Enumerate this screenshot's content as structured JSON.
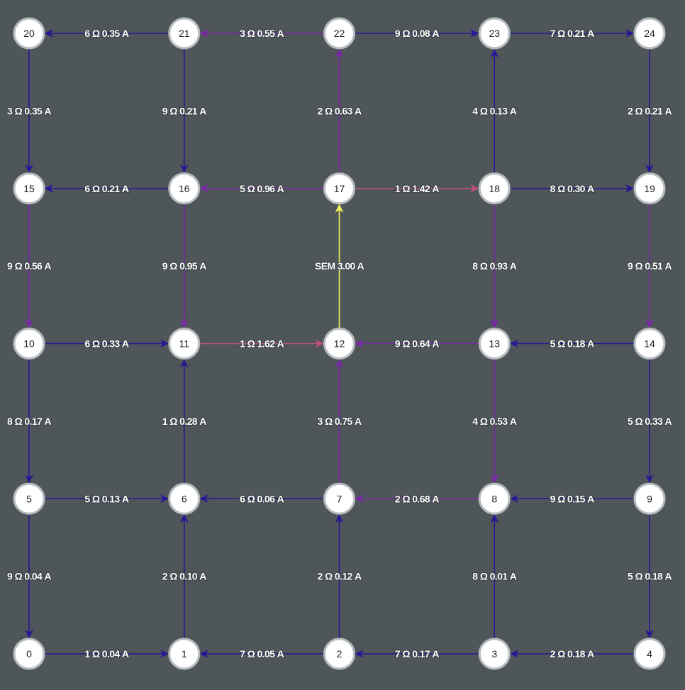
{
  "colors": {
    "background": "#4f5659",
    "node_fill": "#ffffff",
    "node_stroke": "#b7bcbf",
    "current_low": "#2a1596",
    "current_mid": "#7a26a8",
    "current_high": "#c0507a",
    "source": "#f2f25a"
  },
  "nodes": [
    {
      "id": "0",
      "row": 0,
      "col": 0
    },
    {
      "id": "1",
      "row": 0,
      "col": 1
    },
    {
      "id": "2",
      "row": 0,
      "col": 2
    },
    {
      "id": "3",
      "row": 0,
      "col": 3
    },
    {
      "id": "4",
      "row": 0,
      "col": 4
    },
    {
      "id": "5",
      "row": 1,
      "col": 0
    },
    {
      "id": "6",
      "row": 1,
      "col": 1
    },
    {
      "id": "7",
      "row": 1,
      "col": 2
    },
    {
      "id": "8",
      "row": 1,
      "col": 3
    },
    {
      "id": "9",
      "row": 1,
      "col": 4
    },
    {
      "id": "10",
      "row": 2,
      "col": 0
    },
    {
      "id": "11",
      "row": 2,
      "col": 1
    },
    {
      "id": "12",
      "row": 2,
      "col": 2
    },
    {
      "id": "13",
      "row": 2,
      "col": 3
    },
    {
      "id": "14",
      "row": 2,
      "col": 4
    },
    {
      "id": "15",
      "row": 3,
      "col": 0
    },
    {
      "id": "16",
      "row": 3,
      "col": 1
    },
    {
      "id": "17",
      "row": 3,
      "col": 2
    },
    {
      "id": "18",
      "row": 3,
      "col": 3
    },
    {
      "id": "19",
      "row": 3,
      "col": 4
    },
    {
      "id": "20",
      "row": 4,
      "col": 0
    },
    {
      "id": "21",
      "row": 4,
      "col": 1
    },
    {
      "id": "22",
      "row": 4,
      "col": 2
    },
    {
      "id": "23",
      "row": 4,
      "col": 3
    },
    {
      "id": "24",
      "row": 4,
      "col": 4
    }
  ],
  "edges": [
    {
      "from": "0",
      "to": "1",
      "label": "1 Ω 0.04 A",
      "kind": "low"
    },
    {
      "from": "2",
      "to": "1",
      "label": "7 Ω 0.05 A",
      "kind": "low"
    },
    {
      "from": "3",
      "to": "2",
      "label": "7 Ω 0.17 A",
      "kind": "low"
    },
    {
      "from": "4",
      "to": "3",
      "label": "2 Ω 0.18 A",
      "kind": "low"
    },
    {
      "from": "5",
      "to": "6",
      "label": "5 Ω 0.13 A",
      "kind": "low"
    },
    {
      "from": "7",
      "to": "6",
      "label": "6 Ω 0.06 A",
      "kind": "low"
    },
    {
      "from": "8",
      "to": "7",
      "label": "2 Ω 0.68 A",
      "kind": "mid"
    },
    {
      "from": "9",
      "to": "8",
      "label": "9 Ω 0.15 A",
      "kind": "low"
    },
    {
      "from": "10",
      "to": "11",
      "label": "6 Ω 0.33 A",
      "kind": "low"
    },
    {
      "from": "11",
      "to": "12",
      "label": "1 Ω 1.62 A",
      "kind": "high"
    },
    {
      "from": "13",
      "to": "12",
      "label": "9 Ω 0.64 A",
      "kind": "mid"
    },
    {
      "from": "14",
      "to": "13",
      "label": "5 Ω 0.18 A",
      "kind": "low"
    },
    {
      "from": "16",
      "to": "15",
      "label": "6 Ω 0.21 A",
      "kind": "low"
    },
    {
      "from": "17",
      "to": "16",
      "label": "5 Ω 0.96 A",
      "kind": "mid"
    },
    {
      "from": "17",
      "to": "18",
      "label": "1 Ω 1.42 A",
      "kind": "high"
    },
    {
      "from": "18",
      "to": "19",
      "label": "8 Ω 0.30 A",
      "kind": "low"
    },
    {
      "from": "21",
      "to": "20",
      "label": "6 Ω 0.35 A",
      "kind": "low"
    },
    {
      "from": "22",
      "to": "21",
      "label": "3 Ω 0.55 A",
      "kind": "mid"
    },
    {
      "from": "22",
      "to": "23",
      "label": "9 Ω 0.08 A",
      "kind": "low"
    },
    {
      "from": "23",
      "to": "24",
      "label": "7 Ω 0.21 A",
      "kind": "low"
    },
    {
      "from": "5",
      "to": "0",
      "label": "9 Ω 0.04 A",
      "kind": "low"
    },
    {
      "from": "1",
      "to": "6",
      "label": "2 Ω 0.10 A",
      "kind": "low"
    },
    {
      "from": "2",
      "to": "7",
      "label": "2 Ω 0.12 A",
      "kind": "low"
    },
    {
      "from": "3",
      "to": "8",
      "label": "8 Ω 0.01 A",
      "kind": "low"
    },
    {
      "from": "9",
      "to": "4",
      "label": "5 Ω 0.18 A",
      "kind": "low"
    },
    {
      "from": "10",
      "to": "5",
      "label": "8 Ω 0.17 A",
      "kind": "low"
    },
    {
      "from": "6",
      "to": "11",
      "label": "1 Ω 0.28 A",
      "kind": "low"
    },
    {
      "from": "7",
      "to": "12",
      "label": "3 Ω 0.75 A",
      "kind": "mid"
    },
    {
      "from": "13",
      "to": "8",
      "label": "4 Ω 0.53 A",
      "kind": "mid"
    },
    {
      "from": "14",
      "to": "9",
      "label": "5 Ω 0.33 A",
      "kind": "low"
    },
    {
      "from": "15",
      "to": "10",
      "label": "9 Ω 0.56 A",
      "kind": "mid"
    },
    {
      "from": "16",
      "to": "11",
      "label": "9 Ω 0.95 A",
      "kind": "mid"
    },
    {
      "from": "12",
      "to": "17",
      "label": "SEM 3.00 A",
      "kind": "source"
    },
    {
      "from": "18",
      "to": "13",
      "label": "8 Ω 0.93 A",
      "kind": "mid"
    },
    {
      "from": "19",
      "to": "14",
      "label": "9 Ω 0.51 A",
      "kind": "mid"
    },
    {
      "from": "20",
      "to": "15",
      "label": "3 Ω 0.35 A",
      "kind": "low"
    },
    {
      "from": "21",
      "to": "16",
      "label": "9 Ω 0.21 A",
      "kind": "low"
    },
    {
      "from": "17",
      "to": "22",
      "label": "2 Ω 0.63 A",
      "kind": "mid"
    },
    {
      "from": "18",
      "to": "23",
      "label": "4 Ω 0.13 A",
      "kind": "low"
    },
    {
      "from": "24",
      "to": "19",
      "label": "2 Ω 0.21 A",
      "kind": "low"
    }
  ]
}
